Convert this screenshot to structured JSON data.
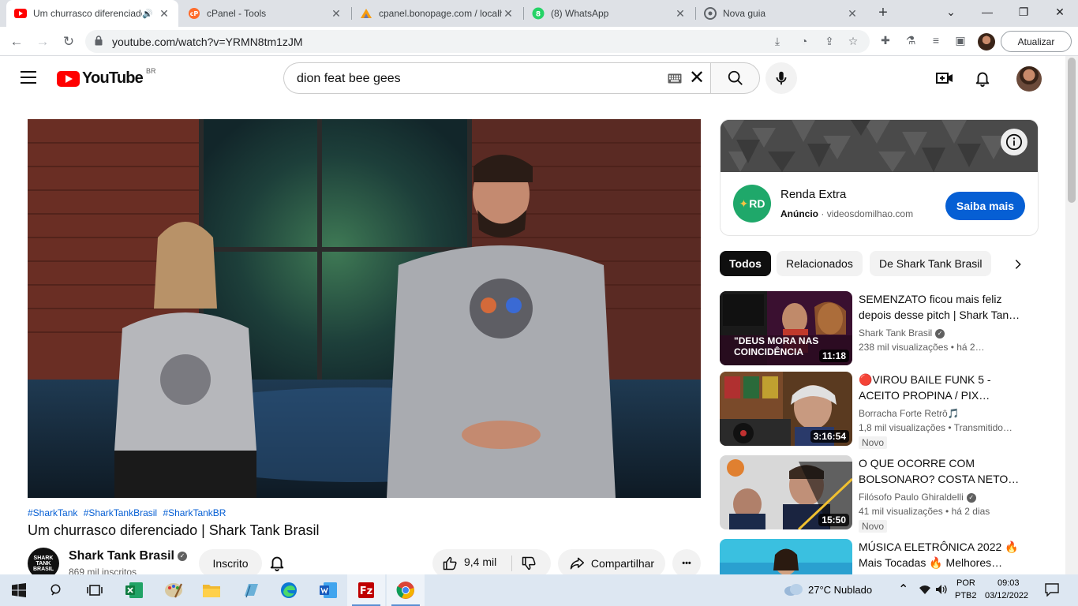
{
  "browser": {
    "tabs": [
      {
        "title": "Um churrasco diferenciado | Shark Tank Brasil - YouTube",
        "active": true
      },
      {
        "title": "cPanel - Tools"
      },
      {
        "title": "cpanel.bonopage.com / localhost / phpMyAdmin"
      },
      {
        "title": "(8) WhatsApp"
      },
      {
        "title": "Nova guia"
      }
    ],
    "url": "youtube.com/watch?v=YRMN8tm1zJM",
    "update_label": "Atualizar",
    "whatsapp_badge": "8"
  },
  "youtube": {
    "country": "BR",
    "logo_text": "YouTube",
    "search_value": "dion feat bee gees"
  },
  "video": {
    "hashtags": [
      "#SharkTank",
      "#SharkTankBrasil",
      "#SharkTankBR"
    ],
    "title": "Um churrasco diferenciado | Shark Tank Brasil",
    "channel": "Shark Tank Brasil",
    "channel_avatar_text": "SHARK TANK BRASIL",
    "subscribers": "869 mil inscritos",
    "subscribe_label": "Inscrito",
    "likes": "9,4 mil",
    "share_label": "Compartilhar",
    "more_label": "•••"
  },
  "ad": {
    "logo_text": "RD",
    "title": "Renda Extra",
    "label": "Anúncio",
    "separator": "·",
    "domain": "videosdomilhao.com",
    "cta": "Saiba mais"
  },
  "chips": [
    "Todos",
    "Relacionados",
    "De Shark Tank Brasil"
  ],
  "recommendations": [
    {
      "title": "SEMENZATO ficou mais feliz depois desse pitch | Shark Tan…",
      "channel": "Shark Tank Brasil",
      "verified": true,
      "meta": "238 mil visualizações  • há 2…",
      "duration": "11:18",
      "thumb_text": "\"DEUS MORA NAS COINCIDÊNCIA"
    },
    {
      "title": "🔴VIROU BAILE FUNK 5 - ACEITO PROPINA / PIX…",
      "channel": "Borracha Forte Retrô🎵",
      "verified": false,
      "meta": "1,8 mil visualizações  • Transmitido…",
      "duration": "3:16:54",
      "badge": "Novo"
    },
    {
      "title": "O QUE OCORRE COM BOLSONARO? COSTA NETO…",
      "channel": "Filósofo Paulo Ghiraldelli",
      "verified": true,
      "meta": "41 mil visualizações  • há 2 dias",
      "duration": "15:50",
      "badge": "Novo"
    },
    {
      "title": "MÚSICA ELETRÔNICA 2022 🔥 Mais Tocadas 🔥 Melhores…",
      "channel": "",
      "meta": "",
      "duration": ""
    }
  ],
  "taskbar": {
    "weather": "27°C  Nublado",
    "lang1": "POR",
    "lang2": "PTB2",
    "time": "09:03",
    "date": "03/12/2022"
  },
  "colors": {
    "youtube_red": "#ff0000",
    "link_blue": "#065fd4",
    "chip_active": "#0f0f0f",
    "ad_logo_green": "#1fa86a"
  }
}
